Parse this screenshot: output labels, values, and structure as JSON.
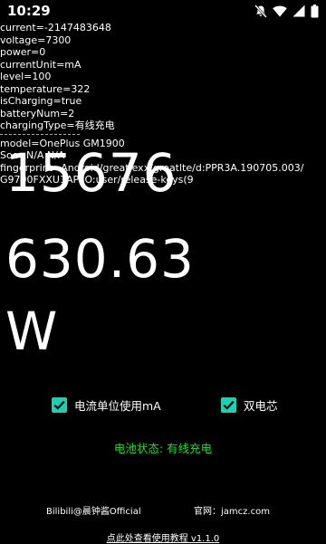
{
  "status_bar": {
    "time": "10:29",
    "icons": [
      "notifications-off-icon",
      "wifi-icon",
      "signal-icon",
      "battery-icon"
    ]
  },
  "info_lines": [
    "current=-2147483648",
    "voltage=7300",
    "power=0",
    "currentUnit=mA",
    "level=100",
    "temperature=322",
    "isCharging=true",
    "batteryNum=2",
    "chargingType=有线充电"
  ],
  "device_lines": [
    "model=OnePlus GM1900",
    "Soc=N/A N/A",
    "fingerprint=Android/greatlexx/greatlte/d:PPR3A.190705.003/",
    "G9700FXXU1APFO:user/release-keys(9"
  ],
  "big_display": [
    "15676",
    "630.63",
    "W"
  ],
  "options": [
    {
      "label": "电流单位使用mA",
      "checked": true
    },
    {
      "label": "双电芯",
      "checked": true
    }
  ],
  "battery_status": "电池状态: 有线充电",
  "footer": {
    "bilibili": "Bilibili@晨钟酱Official",
    "website": "官网：jamcz.com",
    "tutorial_link": "点此处查看使用教程   v1.1.0"
  },
  "colors": {
    "background": "#000000",
    "text": "#ffffff",
    "checkbox": "#19d2b4",
    "status_green": "#19e31e"
  }
}
